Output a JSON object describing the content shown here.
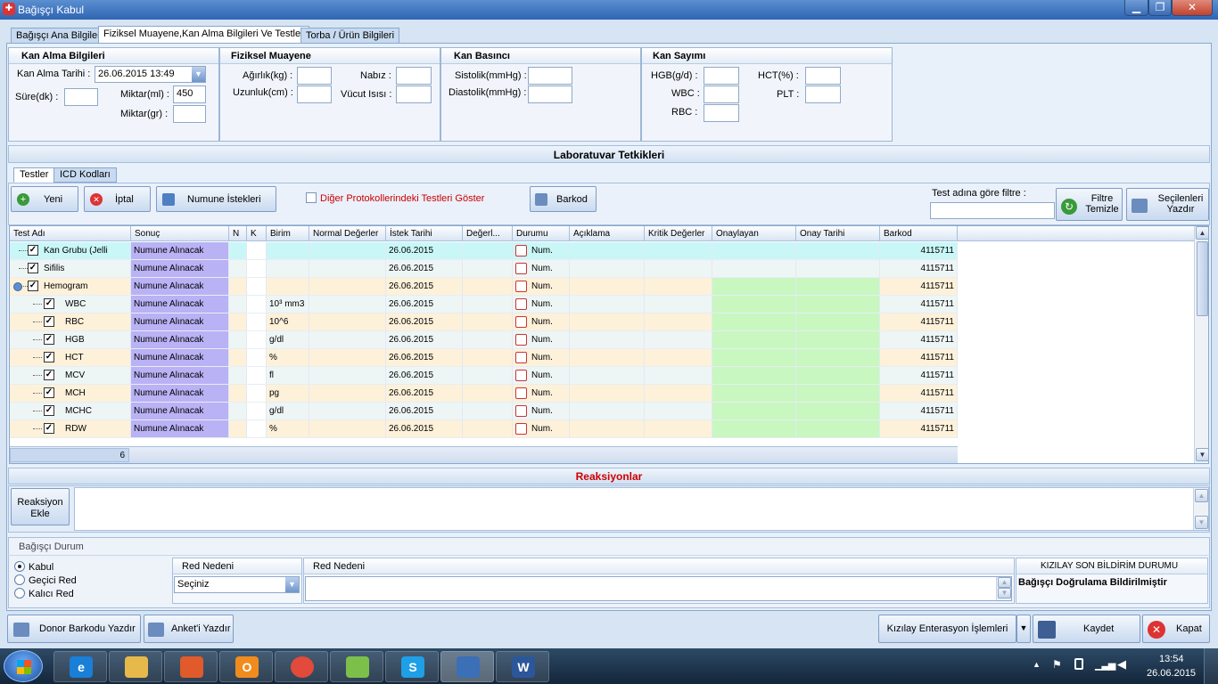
{
  "window": {
    "title": "Bağışçı Kabul",
    "minimize": "▁",
    "maximize": "❐",
    "close": "✕"
  },
  "main_tabs": [
    "Bağışçı Ana Bilgiler",
    "Fiziksel Muayene,Kan Alma Bilgileri Ve Testler",
    "Torba / Ürün Bilgileri"
  ],
  "kan_alma": {
    "title": "Kan Alma Bilgileri",
    "tarih_label": "Kan Alma Tarihi :",
    "tarih_value": "26.06.2015 13:49",
    "sure_label": "Süre(dk) :",
    "sure_value": "",
    "miktar_ml_label": "Miktar(ml) :",
    "miktar_ml_value": "450",
    "miktar_gr_label": "Miktar(gr) :",
    "miktar_gr_value": ""
  },
  "fiziksel": {
    "title": "Fiziksel Muayene",
    "agirlik_label": "Ağırlık(kg) :",
    "nabiz_label": "Nabız :",
    "uzunluk_label": "Uzunluk(cm) :",
    "vucut_label": "Vücut Isısı :"
  },
  "kan_basinci": {
    "title": "Kan Basıncı",
    "sistolik_label": "Sistolik(mmHg) :",
    "diastolik_label": "Diastolik(mmHg) :"
  },
  "kan_sayimi": {
    "title": "Kan Sayımı",
    "hgb_label": "HGB(g/d) :",
    "hct_label": "HCT(%) :",
    "wbc_label": "WBC :",
    "plt_label": "PLT :",
    "rbc_label": "RBC :"
  },
  "lab": {
    "title": "Laboratuvar Tetkikleri",
    "tabs": [
      "Testler",
      "ICD Kodları"
    ],
    "buttons": {
      "yeni": "Yeni",
      "iptal": "İptal",
      "numune": "Numune İstekleri",
      "barkod": "Barkod",
      "filtre": "Filtre Temizle",
      "yazdir": "Seçilenleri Yazdır"
    },
    "checkbox_label": "Diğer Protokollerindeki Testleri Göster",
    "filter_label": "Test adına göre filtre :",
    "filter_value": "",
    "columns": [
      "Test Adı",
      "Sonuç",
      "N",
      "K",
      "Birim",
      "Normal Değerler",
      "İstek Tarihi",
      "Değerl...",
      "Durumu",
      "Açıklama",
      "Kritik Değerler",
      "Onaylayan",
      "Onay Tarihi",
      "Barkod"
    ],
    "rows": [
      {
        "name": "Kan Grubu (Jelli",
        "sonuc": "Numune Alınacak",
        "birim": "",
        "tarih": "26.06.2015",
        "durum": "Num.",
        "barkod": "4115711"
      },
      {
        "name": "Sifilis",
        "sonuc": "Numune Alınacak",
        "birim": "",
        "tarih": "26.06.2015",
        "durum": "Num.",
        "barkod": "4115711"
      },
      {
        "name": "Hemogram",
        "sonuc": "Numune Alınacak",
        "birim": "",
        "tarih": "26.06.2015",
        "durum": "Num.",
        "barkod": "4115711"
      },
      {
        "name": "WBC",
        "sonuc": "Numune Alınacak",
        "birim": "10³ mm3",
        "tarih": "26.06.2015",
        "durum": "Num.",
        "barkod": "4115711"
      },
      {
        "name": "RBC",
        "sonuc": "Numune Alınacak",
        "birim": "10^6",
        "tarih": "26.06.2015",
        "durum": "Num.",
        "barkod": "4115711"
      },
      {
        "name": "HGB",
        "sonuc": "Numune Alınacak",
        "birim": "g/dl",
        "tarih": "26.06.2015",
        "durum": "Num.",
        "barkod": "4115711"
      },
      {
        "name": "HCT",
        "sonuc": "Numune Alınacak",
        "birim": "%",
        "tarih": "26.06.2015",
        "durum": "Num.",
        "barkod": "4115711"
      },
      {
        "name": "MCV",
        "sonuc": "Numune Alınacak",
        "birim": "fl",
        "tarih": "26.06.2015",
        "durum": "Num.",
        "barkod": "4115711"
      },
      {
        "name": "MCH",
        "sonuc": "Numune Alınacak",
        "birim": "pg",
        "tarih": "26.06.2015",
        "durum": "Num.",
        "barkod": "4115711"
      },
      {
        "name": "MCHC",
        "sonuc": "Numune Alınacak",
        "birim": "g/dl",
        "tarih": "26.06.2015",
        "durum": "Num.",
        "barkod": "4115711"
      },
      {
        "name": "RDW",
        "sonuc": "Numune Alınacak",
        "birim": "%",
        "tarih": "26.06.2015",
        "durum": "Num.",
        "barkod": "4115711"
      }
    ],
    "footer_count": "6"
  },
  "reaksiyon": {
    "title": "Reaksiyonlar",
    "button": "Reaksiyon Ekle"
  },
  "durum": {
    "title": "Bağışçı Durum",
    "options": [
      "Kabul",
      "Geçici Red",
      "Kalıcı Red"
    ],
    "selected": "Kabul",
    "red_nedeni_label1": "Red Nedeni",
    "red_nedeni_select": "Seçiniz",
    "red_nedeni_label2": "Red Nedeni",
    "kizilay_label": "KIZILAY SON BİLDİRİM DURUMU",
    "kizilay_value": "Bağışçı Doğrulama Bildirilmiştir"
  },
  "bottom": {
    "donor": "Donor Barkodu Yazdır",
    "anket": "Anket'i Yazdır",
    "entegrasyon": "Kızılay Enterasyon İşlemleri",
    "kaydet": "Kaydet",
    "kapat": "Kapat"
  },
  "taskbar": {
    "time": "13:54",
    "date": "26.06.2015",
    "apps": [
      "internet-explorer-icon",
      "file-explorer-icon",
      "app-icon",
      "outlook-icon",
      "chrome-icon",
      "notes-icon",
      "skype-icon",
      "network-app-icon",
      "word-icon"
    ]
  },
  "colors": {
    "sonuc_bg": "#b9b2f5",
    "onay_bg": "#c8f7c0",
    "row_alt": "#fdf1da",
    "row_first": "#c9f7f7",
    "red_text": "#cc0000"
  }
}
